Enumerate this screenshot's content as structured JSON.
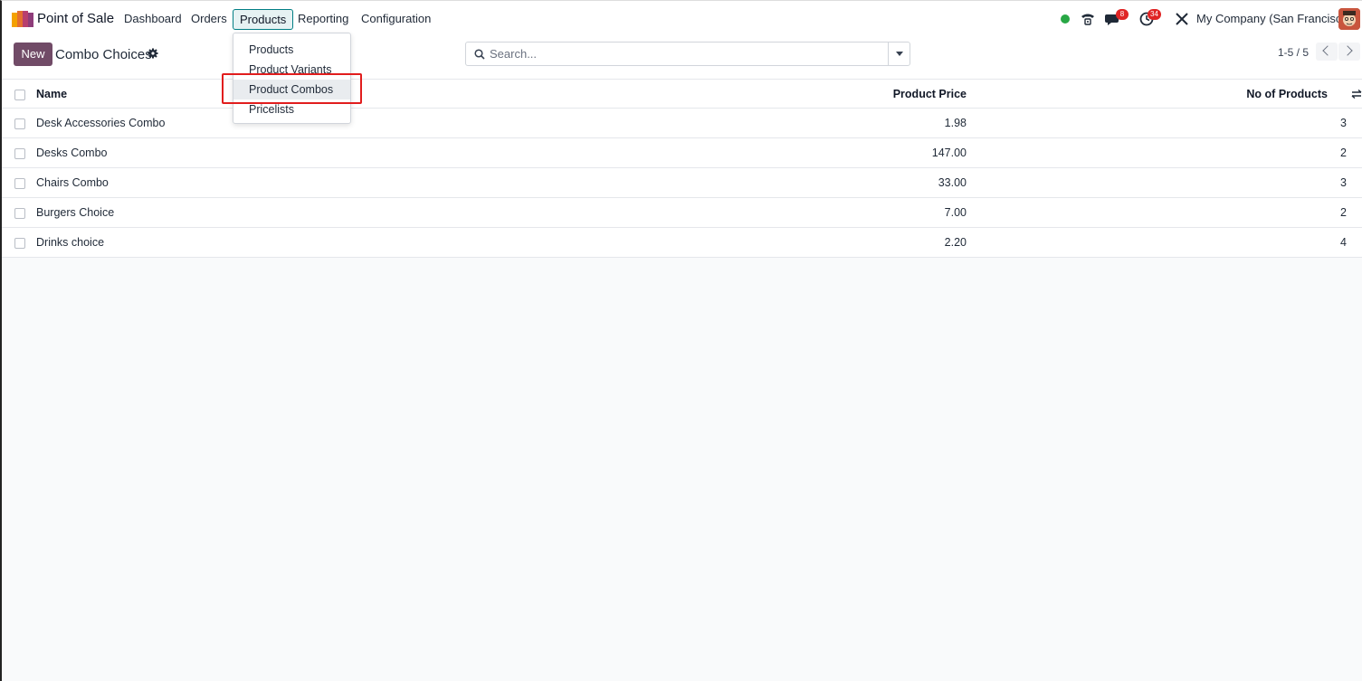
{
  "navbar": {
    "app_name": "Point of Sale",
    "menu": [
      {
        "label": "Dashboard"
      },
      {
        "label": "Orders"
      },
      {
        "label": "Products"
      },
      {
        "label": "Reporting"
      },
      {
        "label": "Configuration"
      }
    ],
    "active_menu": "Products",
    "messages_badge": "8",
    "activities_badge": "34",
    "company": "My Company (San Francisco)"
  },
  "control_panel": {
    "new_label": "New",
    "title": "Combo Choices",
    "search_placeholder": "Search...",
    "pager": "1-5 / 5"
  },
  "dropdown": {
    "items": [
      {
        "label": "Products"
      },
      {
        "label": "Product Variants"
      },
      {
        "label": "Product Combos"
      },
      {
        "label": "Pricelists"
      }
    ],
    "highlighted": "Product Combos"
  },
  "table": {
    "columns": {
      "name": "Name",
      "price": "Product Price",
      "count": "No of Products"
    },
    "rows": [
      {
        "name": "Desk Accessories Combo",
        "price": "1.98",
        "count": "3"
      },
      {
        "name": "Desks Combo",
        "price": "147.00",
        "count": "2"
      },
      {
        "name": "Chairs Combo",
        "price": "33.00",
        "count": "3"
      },
      {
        "name": "Burgers Choice",
        "price": "7.00",
        "count": "2"
      },
      {
        "name": "Drinks choice",
        "price": "2.20",
        "count": "4"
      }
    ]
  },
  "colors": {
    "brand": "#714b67",
    "active_menu_border": "#017e84",
    "highlight": "#e11d1d",
    "presence": "#28a745",
    "badge": "#e02424"
  }
}
